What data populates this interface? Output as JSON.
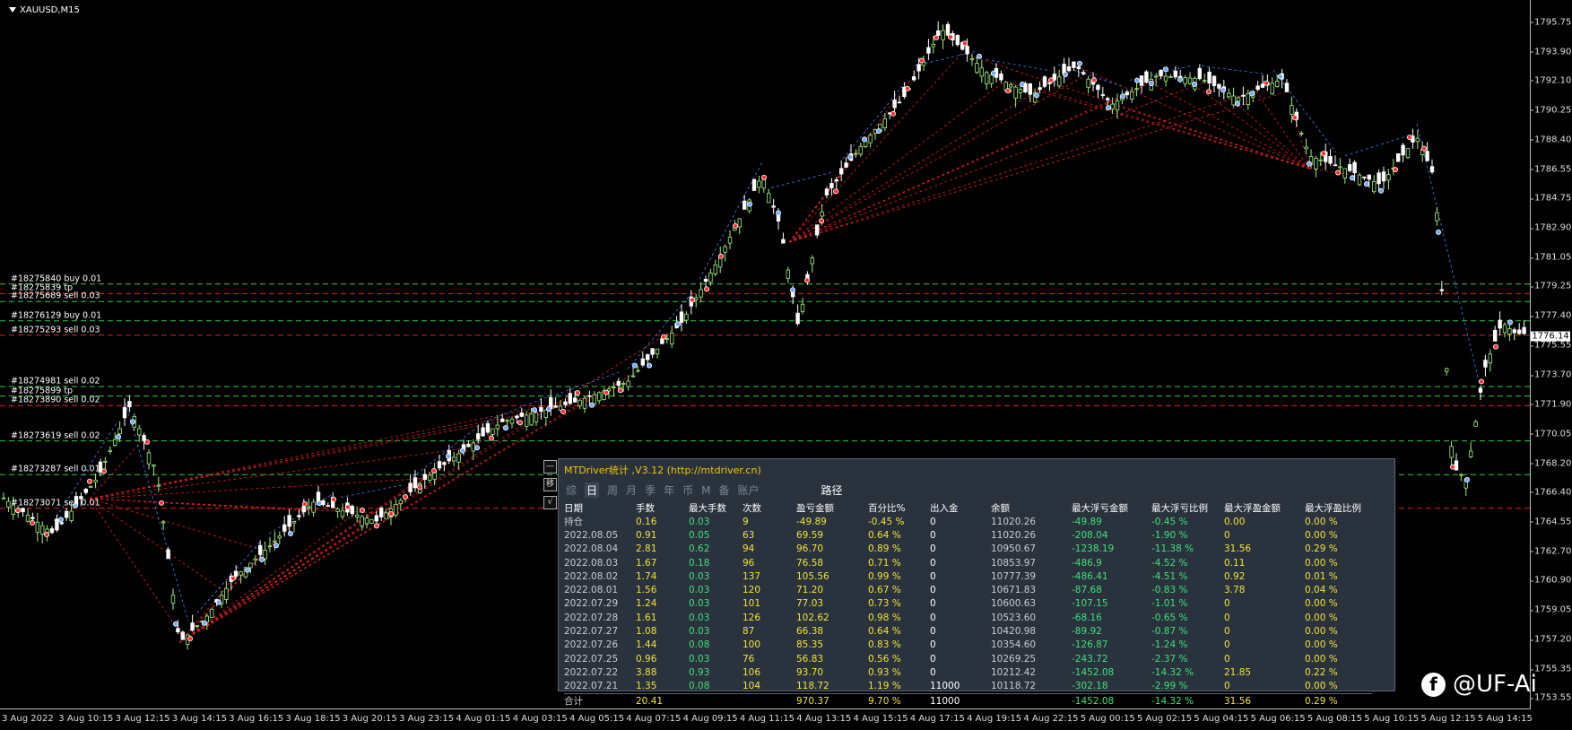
{
  "symbol": "XAUUSD,M15",
  "price_axis": {
    "ticks": [
      "1795.75",
      "1793.90",
      "1792.10",
      "1790.25",
      "1788.40",
      "1786.55",
      "1784.75",
      "1782.90",
      "1781.05",
      "1779.25",
      "1777.40",
      "1775.55",
      "1773.70",
      "1771.90",
      "1770.05",
      "1768.20",
      "1766.40",
      "1764.55",
      "1762.70",
      "1760.90",
      "1759.05",
      "1757.20",
      "1755.35",
      "1753.55"
    ],
    "current": "1776.14"
  },
  "time_axis": [
    "3 Aug 2022",
    "3 Aug 10:15",
    "3 Aug 12:15",
    "3 Aug 14:15",
    "3 Aug 16:15",
    "3 Aug 18:15",
    "3 Aug 20:15",
    "3 Aug 23:15",
    "4 Aug 01:15",
    "4 Aug 03:15",
    "4 Aug 05:15",
    "4 Aug 07:15",
    "4 Aug 09:15",
    "4 Aug 11:15",
    "4 Aug 13:15",
    "4 Aug 15:15",
    "4 Aug 17:15",
    "4 Aug 19:15",
    "4 Aug 22:15",
    "5 Aug 00:15",
    "5 Aug 02:15",
    "5 Aug 04:15",
    "5 Aug 06:15",
    "5 Aug 08:15",
    "5 Aug 10:15",
    "5 Aug 12:15",
    "5 Aug 14:15"
  ],
  "order_labels": [
    {
      "text": "#18275840 buy 0.01",
      "price": 1779.4
    },
    {
      "text": "#18275839 tp",
      "price": 1778.8
    },
    {
      "text": "#18275689 sell 0.03",
      "price": 1778.3
    },
    {
      "text": "#18276129 buy 0.01",
      "price": 1777.1
    },
    {
      "text": "#18275293 sell 0.03",
      "price": 1776.2
    },
    {
      "text": "#18274981 sell 0.02",
      "price": 1773.0
    },
    {
      "text": "#18275899 tp",
      "price": 1772.4
    },
    {
      "text": "#18273890 sell 0.02",
      "price": 1771.8
    },
    {
      "text": "#18273619 sell 0.02",
      "price": 1769.6
    },
    {
      "text": "#18273287 sell 0.01",
      "price": 1767.5
    },
    {
      "text": "#18273071 sell 0.01",
      "price": 1765.4
    }
  ],
  "panel": {
    "title": "MTDriver统计 ,V3.12 (http://mtdriver.cn)",
    "tabs": [
      "综",
      "日",
      "周",
      "月",
      "季",
      "年",
      "币",
      "M",
      "备",
      "账户"
    ],
    "active_tab": "日",
    "path_tab": "路径",
    "side_buttons": [
      "—",
      "移",
      "√"
    ],
    "headers": [
      "日期",
      "手数",
      "最大手数",
      "次数",
      "盈亏金额",
      "百分比%",
      "出入金",
      "余额",
      "最大浮亏金额",
      "最大浮亏比例",
      "最大浮盈金额",
      "最大浮盈比例"
    ],
    "rows": [
      [
        "持仓",
        "0.16",
        "0.03",
        "9",
        "-49.89",
        "-0.45 %",
        "0",
        "11020.26",
        "-49.89",
        "-0.45 %",
        "0.00",
        "0.00 %"
      ],
      [
        "2022.08.05",
        "0.91",
        "0.05",
        "63",
        "69.59",
        "0.64 %",
        "0",
        "11020.26",
        "-208.04",
        "-1.90 %",
        "0",
        "0.00 %"
      ],
      [
        "2022.08.04",
        "2.81",
        "0.62",
        "94",
        "96.70",
        "0.89 %",
        "0",
        "10950.67",
        "-1238.19",
        "-11.38 %",
        "31.56",
        "0.29 %"
      ],
      [
        "2022.08.03",
        "1.67",
        "0.18",
        "96",
        "76.58",
        "0.71 %",
        "0",
        "10853.97",
        "-486.9",
        "-4.52 %",
        "0.11",
        "0.00 %"
      ],
      [
        "2022.08.02",
        "1.74",
        "0.03",
        "137",
        "105.56",
        "0.99 %",
        "0",
        "10777.39",
        "-486.41",
        "-4.51 %",
        "0.92",
        "0.01 %"
      ],
      [
        "2022.08.01",
        "1.56",
        "0.03",
        "120",
        "71.20",
        "0.67 %",
        "0",
        "10671.83",
        "-87.68",
        "-0.83 %",
        "3.78",
        "0.04 %"
      ],
      [
        "2022.07.29",
        "1.24",
        "0.03",
        "101",
        "77.03",
        "0.73 %",
        "0",
        "10600.63",
        "-107.15",
        "-1.01 %",
        "0",
        "0.00 %"
      ],
      [
        "2022.07.28",
        "1.61",
        "0.03",
        "126",
        "102.62",
        "0.98 %",
        "0",
        "10523.60",
        "-68.16",
        "-0.65 %",
        "0",
        "0.00 %"
      ],
      [
        "2022.07.27",
        "1.08",
        "0.03",
        "87",
        "66.38",
        "0.64 %",
        "0",
        "10420.98",
        "-89.92",
        "-0.87 %",
        "0",
        "0.00 %"
      ],
      [
        "2022.07.26",
        "1.44",
        "0.08",
        "100",
        "85.35",
        "0.83 %",
        "0",
        "10354.60",
        "-126.87",
        "-1.24 %",
        "0",
        "0.00 %"
      ],
      [
        "2022.07.25",
        "0.96",
        "0.03",
        "76",
        "56.83",
        "0.56 %",
        "0",
        "10269.25",
        "-243.72",
        "-2.37 %",
        "0",
        "0.00 %"
      ],
      [
        "2022.07.22",
        "3.88",
        "0.93",
        "106",
        "93.70",
        "0.93 %",
        "0",
        "10212.42",
        "-1452.08",
        "-14.32 %",
        "21.85",
        "0.22 %"
      ],
      [
        "2022.07.21",
        "1.35",
        "0.08",
        "104",
        "118.72",
        "1.19 %",
        "11000",
        "10118.72",
        "-302.18",
        "-2.99 %",
        "0",
        "0.00 %"
      ]
    ],
    "total": [
      "合计",
      "20.41",
      "",
      "",
      "970.37",
      "9.70 %",
      "11000",
      "",
      "-1452.08",
      "-14.32 %",
      "31.56",
      "0.29 %"
    ]
  },
  "watermark": "@UF-Ai",
  "colors": {
    "bull": "#9ef07a",
    "bear": "#ffffff",
    "order_line_green": "#2ecc40",
    "order_line_red": "#e02020",
    "path_red": "#e02020",
    "path_blue": "#4a78ff",
    "panel_bg": "#2a323e"
  }
}
